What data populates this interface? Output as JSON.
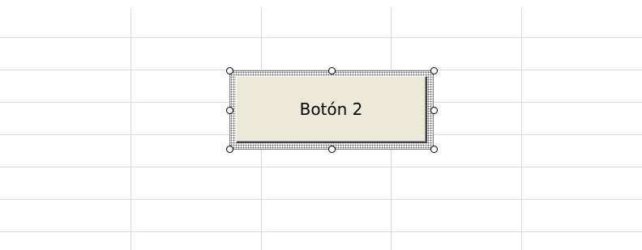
{
  "button": {
    "label": "Botón 2"
  }
}
